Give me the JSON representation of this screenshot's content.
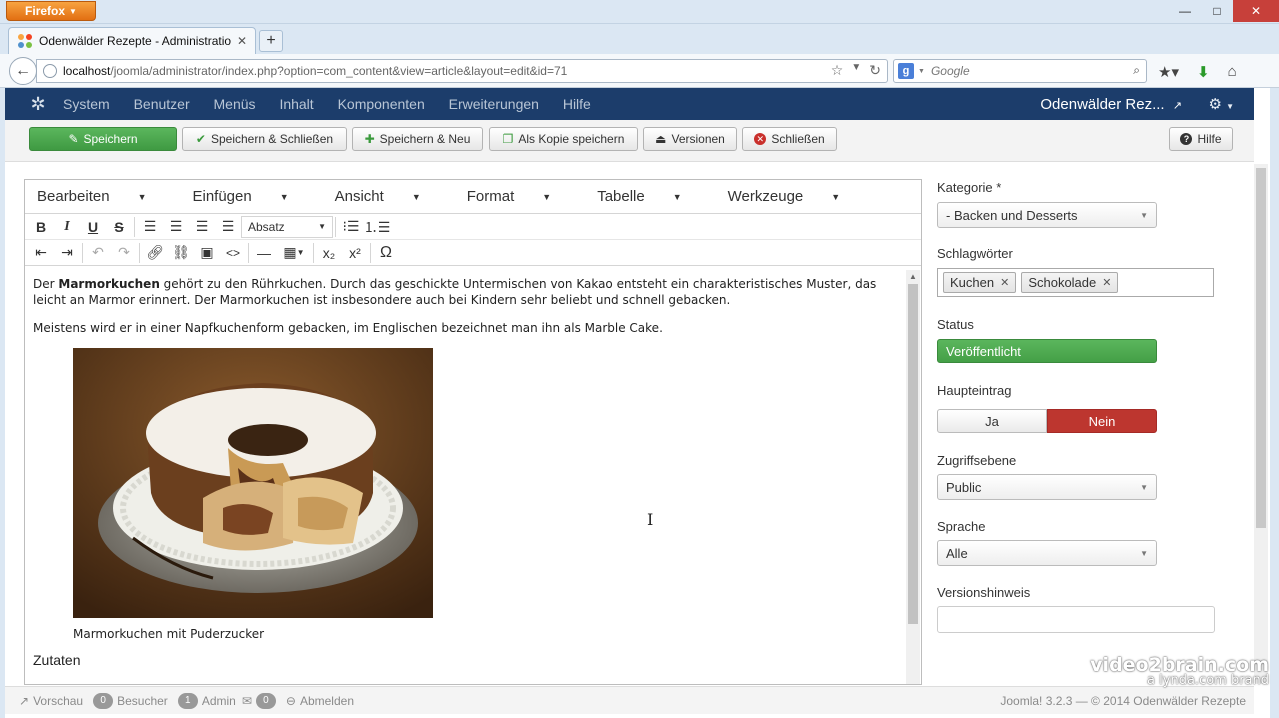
{
  "browser": {
    "app_button": "Firefox",
    "tab_title": "Odenwälder Rezepte - Administration - l...",
    "url_host": "localhost",
    "url_path": "/joomla/administrator/index.php?option=com_content&view=article&layout=edit&id=71",
    "search_placeholder": "Google",
    "window_controls": [
      "—",
      "□",
      "✕"
    ]
  },
  "header": {
    "menu": [
      "System",
      "Benutzer",
      "Menüs",
      "Inhalt",
      "Komponenten",
      "Erweiterungen",
      "Hilfe"
    ],
    "site_name": "Odenwälder Rez..."
  },
  "toolbar": {
    "save": "Speichern",
    "save_close": "Speichern & Schließen",
    "save_new": "Speichern & Neu",
    "save_copy": "Als Kopie speichern",
    "versions": "Versionen",
    "close": "Schließen",
    "help": "Hilfe"
  },
  "editor": {
    "menubar": [
      "Bearbeiten",
      "Einfügen",
      "Ansicht",
      "Format",
      "Tabelle",
      "Werkzeuge"
    ],
    "format_select": "Absatz",
    "content": {
      "p1_prefix": "Der ",
      "p1_bold": "Marmorkuchen",
      "p1_rest": " gehört zu den Rührkuchen. Durch das geschickte Untermischen von Kakao entsteht ein charakteristisches Muster, das leicht an Marmor erinnert. Der Marmorkuchen ist insbesondere auch bei Kindern sehr beliebt und schnell gebacken.",
      "p2": "Meistens wird er in einer Napfkuchenform gebacken, im Englischen bezeichnet man ihn als Marble Cake.",
      "caption": "Marmorkuchen mit Puderzucker",
      "heading": "Zutaten"
    }
  },
  "sidebar": {
    "kategorie_label": "Kategorie *",
    "kategorie_value": "- Backen und Desserts",
    "tags_label": "Schlagwörter",
    "tags": [
      "Kuchen",
      "Schokolade"
    ],
    "status_label": "Status",
    "status_value": "Veröffentlicht",
    "featured_label": "Haupteintrag",
    "featured_yes": "Ja",
    "featured_no": "Nein",
    "access_label": "Zugriffsebene",
    "access_value": "Public",
    "language_label": "Sprache",
    "language_value": "Alle",
    "version_note_label": "Versionshinweis",
    "version_note_value": ""
  },
  "footer": {
    "preview": "Vorschau",
    "visitors_count": "0",
    "visitors": "Besucher",
    "admin_count": "1",
    "admin": "Admin",
    "messages_count": "0",
    "logout": "Abmelden",
    "copyright": "Joomla! 3.2.3  —  © 2014 Odenwälder Rezepte"
  },
  "watermark": {
    "line1": "video2brain.com",
    "line2": "a lynda.com brand"
  },
  "colors": {
    "header_bg": "#1c3d6b",
    "save_green": "#46a546",
    "nein_red": "#bd362f"
  }
}
